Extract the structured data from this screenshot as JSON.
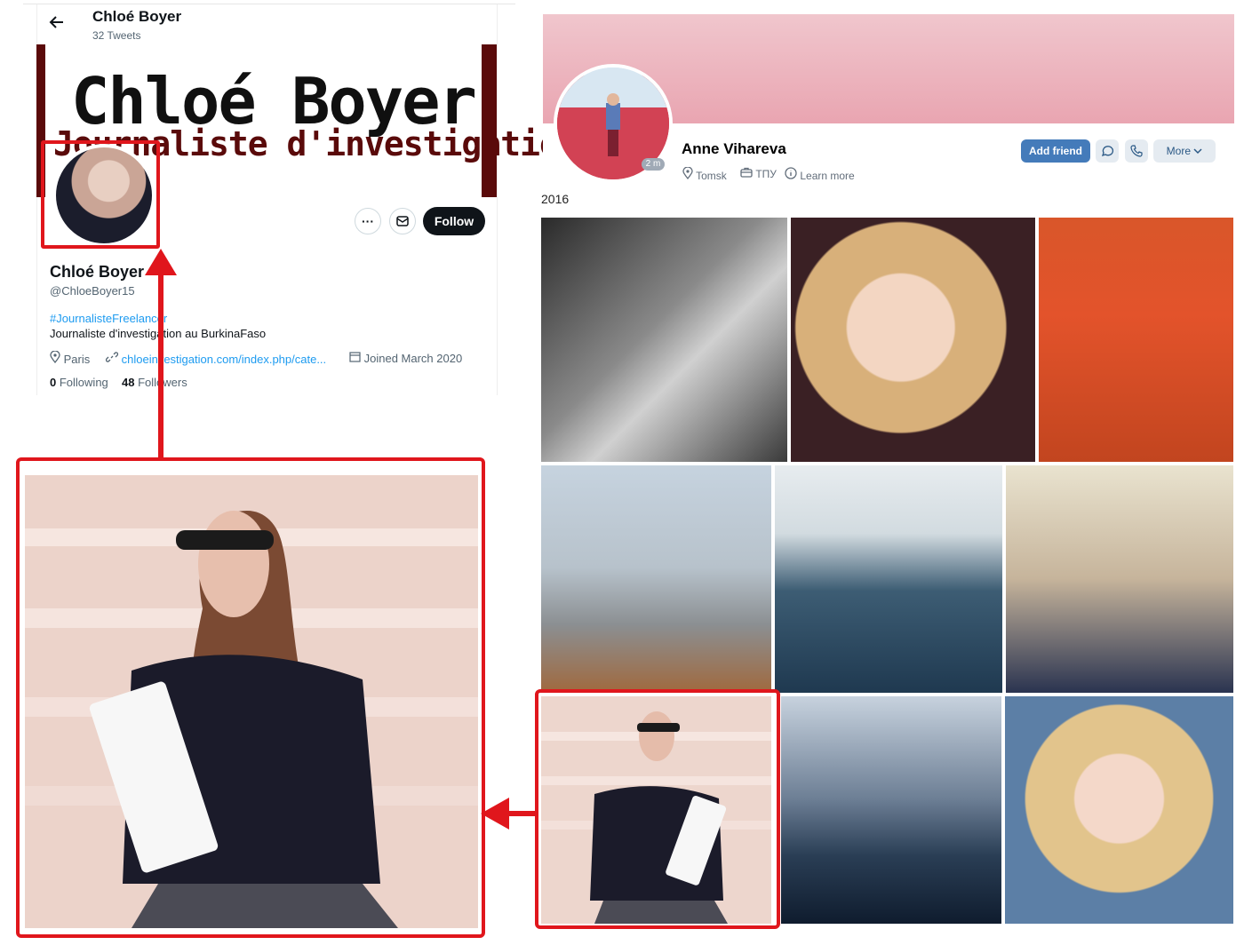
{
  "twitter": {
    "header_name": "Chloé Boyer",
    "tweet_count": "32 Tweets",
    "banner_title": "Chloé Boyer",
    "banner_subtitle": "Journaliste d'investigation",
    "follow_label": "Follow",
    "display_name": "Chloé Boyer",
    "handle": "@ChloeBoyer15",
    "hashtag": "#JournalisteFreelancer",
    "bio": "Journaliste d'investigation au BurkinaFaso",
    "location": "Paris",
    "link": "chloeinvestigation.com/index.php/cate...",
    "joined": "Joined March 2020",
    "following_count": "0",
    "following_label": "Following",
    "followers_count": "48",
    "followers_label": "Followers"
  },
  "vk": {
    "name": "Anne Vihareva",
    "online_badge": "2 m",
    "city": "Tomsk",
    "work": "ТПУ",
    "learn_more": "Learn more",
    "add_friend": "Add friend",
    "more": "More",
    "year": "2016"
  },
  "colors": {
    "highlight_red": "#e0161c",
    "vk_blue": "#447bba",
    "twitter_blue": "#1d9bf0"
  }
}
